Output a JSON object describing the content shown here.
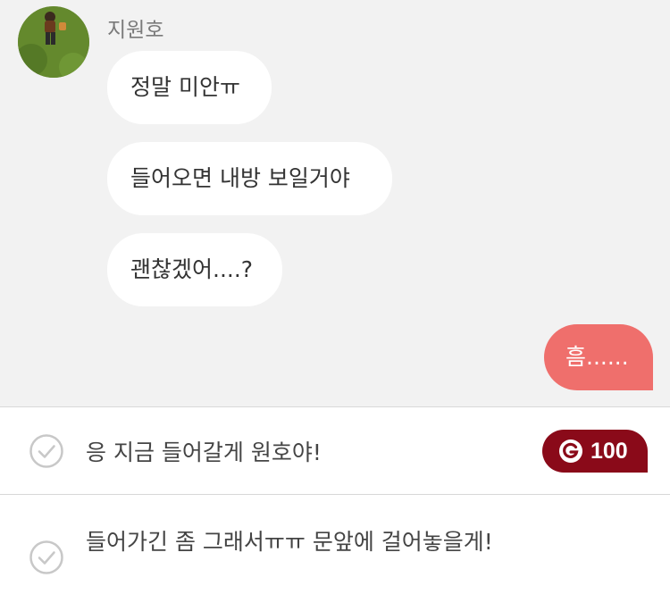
{
  "chat": {
    "sender_name": "지원호",
    "avatar_icon": "profile-photo-grass",
    "messages_in": [
      {
        "text": "정말 미안ㅠ"
      },
      {
        "text": "들어오면 내방 보일거야"
      },
      {
        "text": "괜찮겠어....?"
      }
    ],
    "message_out": {
      "text": "흠......"
    }
  },
  "choices": [
    {
      "text": "응 지금 들어갈게 원호야!",
      "cost": "100",
      "icon": "check-circle-icon"
    },
    {
      "text": "들어가긴 좀 그래서ㅠㅠ 문앞에 걸어놓을게!",
      "icon": "check-circle-icon"
    }
  ],
  "colors": {
    "chat_background": "#f2f2f2",
    "outgoing_bubble": "#ef6f6c",
    "cost_badge": "#8a0a19"
  }
}
